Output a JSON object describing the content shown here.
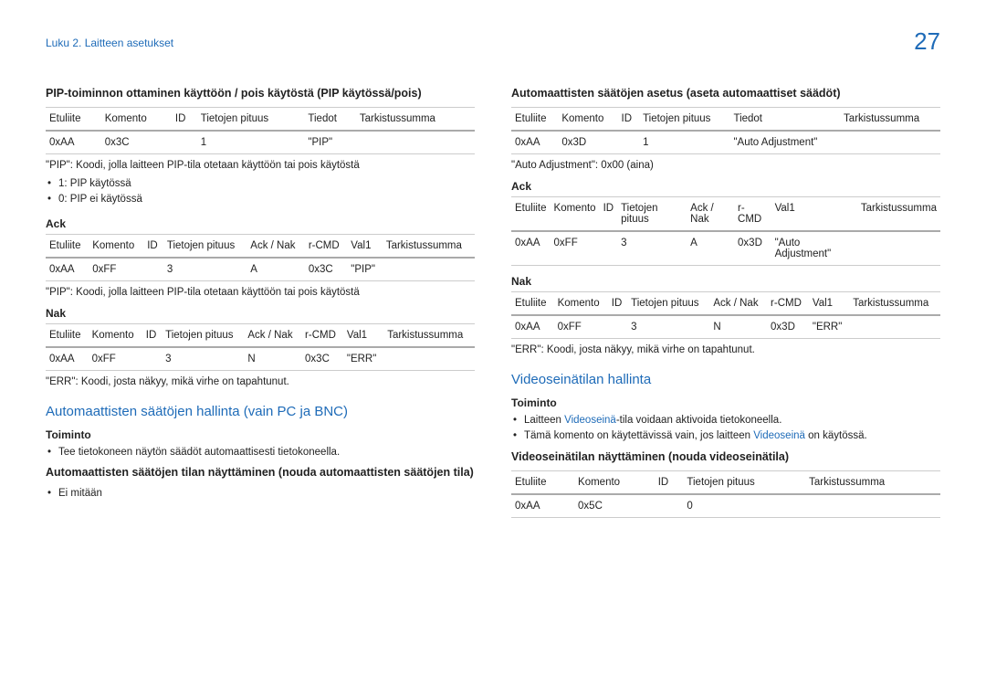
{
  "header": {
    "breadcrumb": "Luku 2. Laitteen asetukset",
    "page_number": "27"
  },
  "left": {
    "section1": {
      "title": "PIP-toiminnon ottaminen käyttöön / pois käytöstä (PIP käytössä/pois)",
      "table1": {
        "headers": [
          "Etuliite",
          "Komento",
          "ID",
          "Tietojen pituus",
          "Tiedot",
          "Tarkistussumma"
        ],
        "row": [
          "0xAA",
          "0x3C",
          "",
          "1",
          "\"PIP\"",
          ""
        ]
      },
      "note1": "\"PIP\": Koodi, jolla laitteen PIP-tila otetaan käyttöön tai pois käytöstä",
      "bullets1": [
        "1: PIP käytössä",
        "0: PIP ei käytössä"
      ],
      "ack": {
        "title": "Ack",
        "headers": [
          "Etuliite",
          "Komento",
          "ID",
          "Tietojen pituus",
          "Ack / Nak",
          "r-CMD",
          "Val1",
          "Tarkistussumma"
        ],
        "row": [
          "0xAA",
          "0xFF",
          "",
          "3",
          "A",
          "0x3C",
          "\"PIP\"",
          ""
        ]
      },
      "note2": "\"PIP\": Koodi, jolla laitteen PIP-tila otetaan käyttöön tai pois käytöstä",
      "nak": {
        "title": "Nak",
        "headers": [
          "Etuliite",
          "Komento",
          "ID",
          "Tietojen pituus",
          "Ack / Nak",
          "r-CMD",
          "Val1",
          "Tarkistussumma"
        ],
        "row": [
          "0xAA",
          "0xFF",
          "",
          "3",
          "N",
          "0x3C",
          "\"ERR\"",
          ""
        ]
      },
      "note3": "\"ERR\": Koodi, josta näkyy, mikä virhe on tapahtunut."
    },
    "section2": {
      "title": "Automaattisten säätöjen hallinta (vain PC ja BNC)",
      "toiminto": "Toiminto",
      "bullets": [
        "Tee tietokoneen näytön säädöt automaattisesti tietokoneella."
      ],
      "subtitle2": "Automaattisten säätöjen tilan näyttäminen (nouda automaattisten säätöjen tila)",
      "bullets2": [
        "Ei mitään"
      ]
    }
  },
  "right": {
    "section1": {
      "title": "Automaattisten säätöjen asetus (aseta automaattiset säädöt)",
      "table1": {
        "headers": [
          "Etuliite",
          "Komento",
          "ID",
          "Tietojen pituus",
          "Tiedot",
          "Tarkistussumma"
        ],
        "row": [
          "0xAA",
          "0x3D",
          "",
          "1",
          "\"Auto Adjustment\"",
          ""
        ]
      },
      "note1": "\"Auto Adjustment\": 0x00 (aina)",
      "ack": {
        "title": "Ack",
        "headers": [
          "Etuliite",
          "Komento",
          "ID",
          "Tietojen pituus",
          "Ack / Nak",
          "r-CMD",
          "Val1",
          "Tarkistussumma"
        ],
        "row": [
          "0xAA",
          "0xFF",
          "",
          "3",
          "A",
          "0x3D",
          "\"Auto Adjustment\"",
          ""
        ]
      },
      "nak": {
        "title": "Nak",
        "headers": [
          "Etuliite",
          "Komento",
          "ID",
          "Tietojen pituus",
          "Ack / Nak",
          "r-CMD",
          "Val1",
          "Tarkistussumma"
        ],
        "row": [
          "0xAA",
          "0xFF",
          "",
          "3",
          "N",
          "0x3D",
          "\"ERR\"",
          ""
        ]
      },
      "note2": "\"ERR\": Koodi, josta näkyy, mikä virhe on tapahtunut."
    },
    "section2": {
      "title": "Videoseinätilan hallinta",
      "toiminto": "Toiminto",
      "bullet1_pre": "Laitteen ",
      "bullet1_blue": "Videoseinä",
      "bullet1_post": "-tila voidaan aktivoida tietokoneella.",
      "bullet2_pre": "Tämä komento on käytettävissä vain, jos laitteen ",
      "bullet2_blue": "Videoseinä",
      "bullet2_post": " on käytössä.",
      "subtitle2": "Videoseinätilan näyttäminen (nouda videoseinätila)",
      "table2": {
        "headers": [
          "Etuliite",
          "Komento",
          "ID",
          "Tietojen pituus",
          "Tarkistussumma"
        ],
        "row": [
          "0xAA",
          "0x5C",
          "",
          "0",
          ""
        ]
      }
    }
  }
}
